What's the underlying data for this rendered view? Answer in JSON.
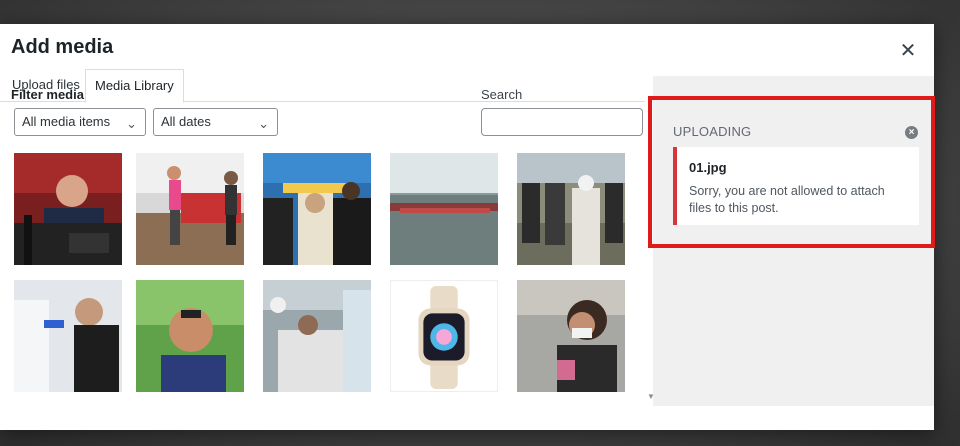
{
  "modal": {
    "title": "Add media",
    "close_icon": "close-icon"
  },
  "tabs": [
    {
      "label": "Upload files",
      "active": false
    },
    {
      "label": "Media Library",
      "active": true
    }
  ],
  "filters": {
    "label": "Filter media",
    "type_select": "All media items",
    "date_select": "All dates"
  },
  "search": {
    "label": "Search",
    "value": ""
  },
  "media_items": [
    {
      "name": "man-at-podium"
    },
    {
      "name": "skipping-rope-training"
    },
    {
      "name": "officials-ceremony"
    },
    {
      "name": "river-crowd"
    },
    {
      "name": "masked-crowd"
    },
    {
      "name": "covid-test"
    },
    {
      "name": "smiling-man-portrait"
    },
    {
      "name": "hospital-patient"
    },
    {
      "name": "smartwatch-product"
    },
    {
      "name": "woman-in-mask"
    }
  ],
  "uploader": {
    "heading": "UPLOADING",
    "dismiss_icon": "dismiss-icon",
    "error": {
      "filename": "01.jpg",
      "message": "Sorry, you are not allowed to attach files to this post."
    }
  },
  "colors": {
    "error_border": "#d63638",
    "highlight_box": "#e01919",
    "sidebar_bg": "#f0f0f1"
  }
}
